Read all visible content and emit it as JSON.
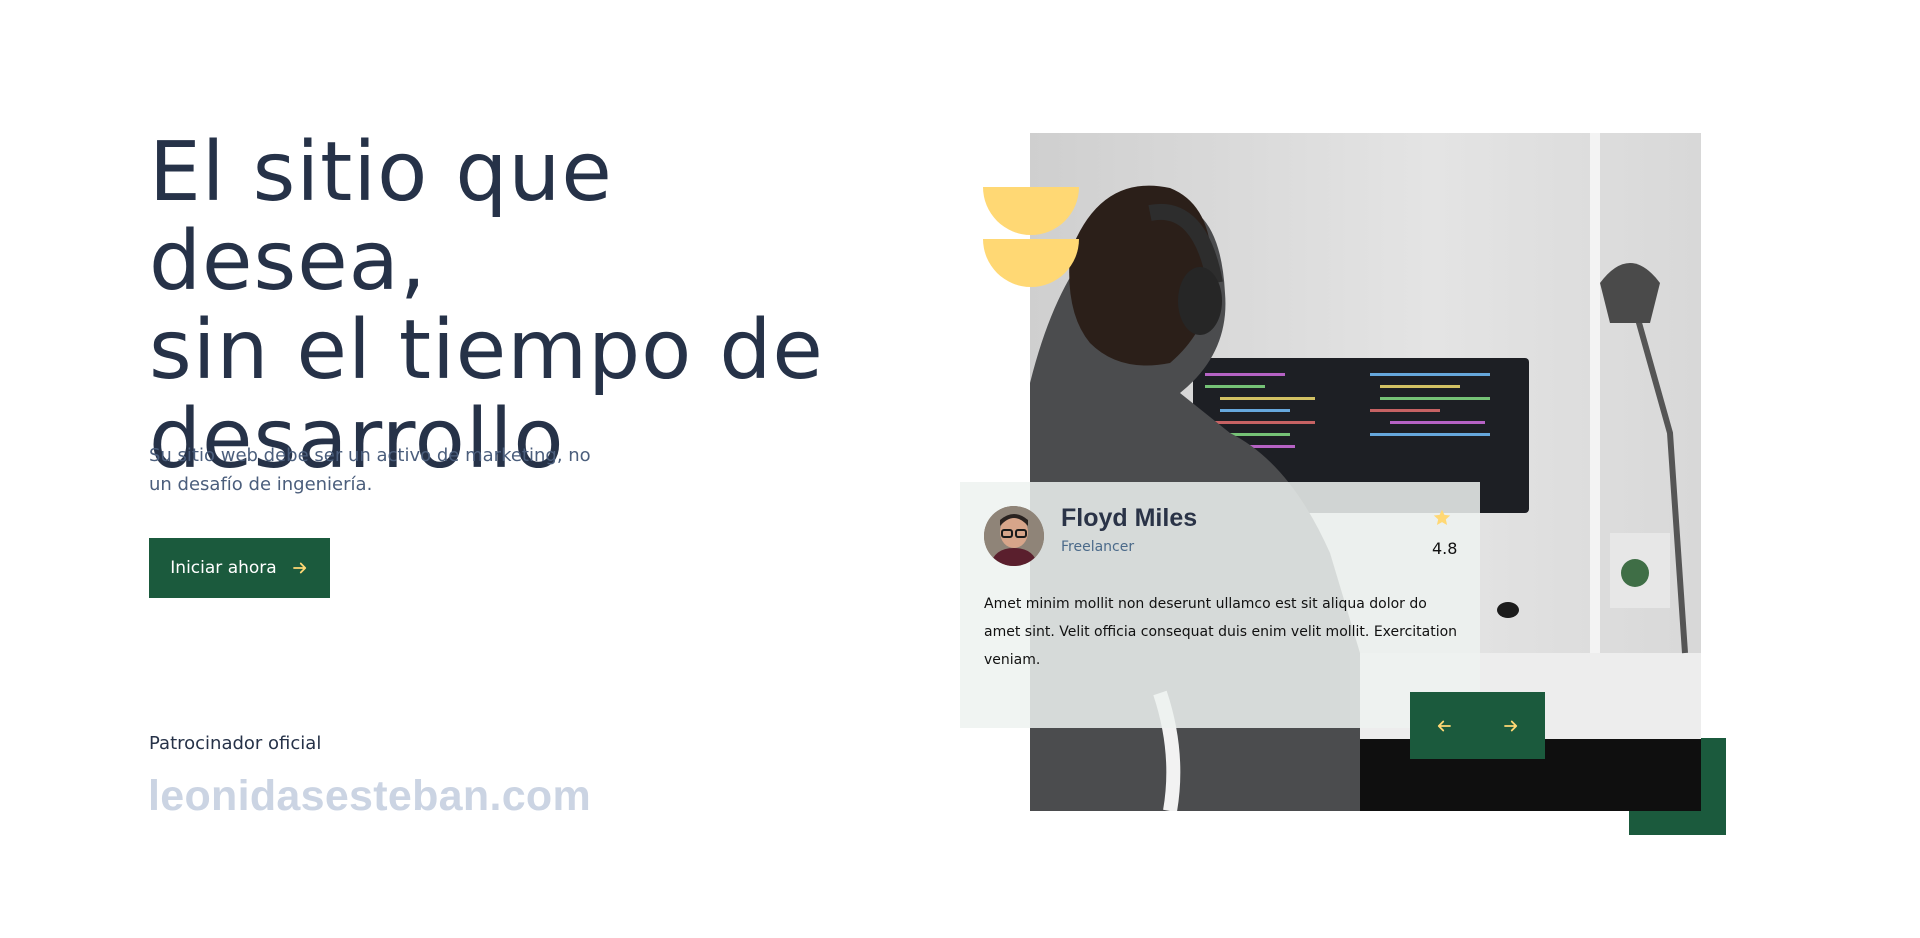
{
  "hero": {
    "title_lines": [
      "El sitio que desea,",
      "sin el tiempo de",
      "desarrollo"
    ],
    "subtitle": "Su sitio web debe ser un activo de marketing, no un desafío de ingeniería.",
    "cta_label": "Iniciar ahora"
  },
  "sponsor": {
    "label": "Patrocinador oficial",
    "logo_text": "leonidasesteban.com"
  },
  "testimonial": {
    "name": "Floyd Miles",
    "role": "Freelancer",
    "rating": "4.8",
    "quote": "Amet minim mollit non deserunt ullamco est sit aliqua dolor do amet sint. Velit officia consequat duis enim velit mollit. Exercitation veniam."
  },
  "icons": {
    "cta_arrow": "arrow-right-icon",
    "star": "star-icon",
    "prev": "arrow-left-icon",
    "next": "arrow-right-icon"
  },
  "colors": {
    "brand_green": "#1b5a3d",
    "accent_yellow": "#ffd874",
    "title_color": "#263248",
    "logo_gray": "#cbd4e3"
  }
}
